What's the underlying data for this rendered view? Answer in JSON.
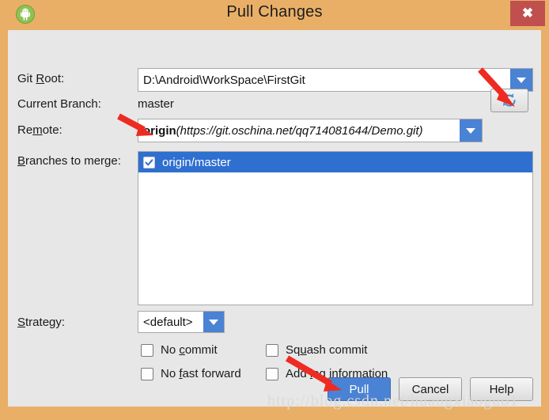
{
  "window": {
    "title": "Pull Changes",
    "app_icon": "android-studio-icon",
    "close_label": "✖",
    "titlebar_color": "#e9af67",
    "close_color": "#c0504d",
    "accent_color": "#4a82d4",
    "selection_color": "#2f6fd0",
    "annotation_color": "#ee2b22"
  },
  "form": {
    "git_root": {
      "label_pre": "Git ",
      "label_mnemonic": "R",
      "label_post": "oot:",
      "value": "D:\\Android\\WorkSpace\\FirstGit"
    },
    "current_branch": {
      "label": "Current Branch:",
      "value": "master"
    },
    "remote": {
      "label_pre": "Re",
      "label_mnemonic": "m",
      "label_post": "ote:",
      "name": "origin",
      "url": "(https://git.oschina.net/qq714081644/Demo.git)",
      "refresh_icon": "refresh-icon"
    },
    "branches": {
      "label_pre": "",
      "label_mnemonic": "B",
      "label_post": "ranches to merge:",
      "items": [
        {
          "label": "origin/master",
          "checked": true,
          "selected": true
        }
      ]
    },
    "strategy": {
      "label_pre": "",
      "label_mnemonic": "S",
      "label_post": "trategy:",
      "value": "<default>"
    },
    "options": [
      {
        "label_pre": "No ",
        "label_mnemonic": "c",
        "label_post": "ommit",
        "checked": false
      },
      {
        "label_pre": "Sq",
        "label_mnemonic": "u",
        "label_post": "ash commit",
        "checked": false
      },
      {
        "label_pre": "No ",
        "label_mnemonic": "f",
        "label_post": "ast forward",
        "checked": false
      },
      {
        "label_pre": "Add ",
        "label_mnemonic": "l",
        "label_post": "og information",
        "checked": false
      }
    ]
  },
  "buttons": {
    "pull": "Pull",
    "cancel": "Cancel",
    "help": "Help"
  },
  "watermark": "http://blog.csdn.net/huangxiaoguo1"
}
